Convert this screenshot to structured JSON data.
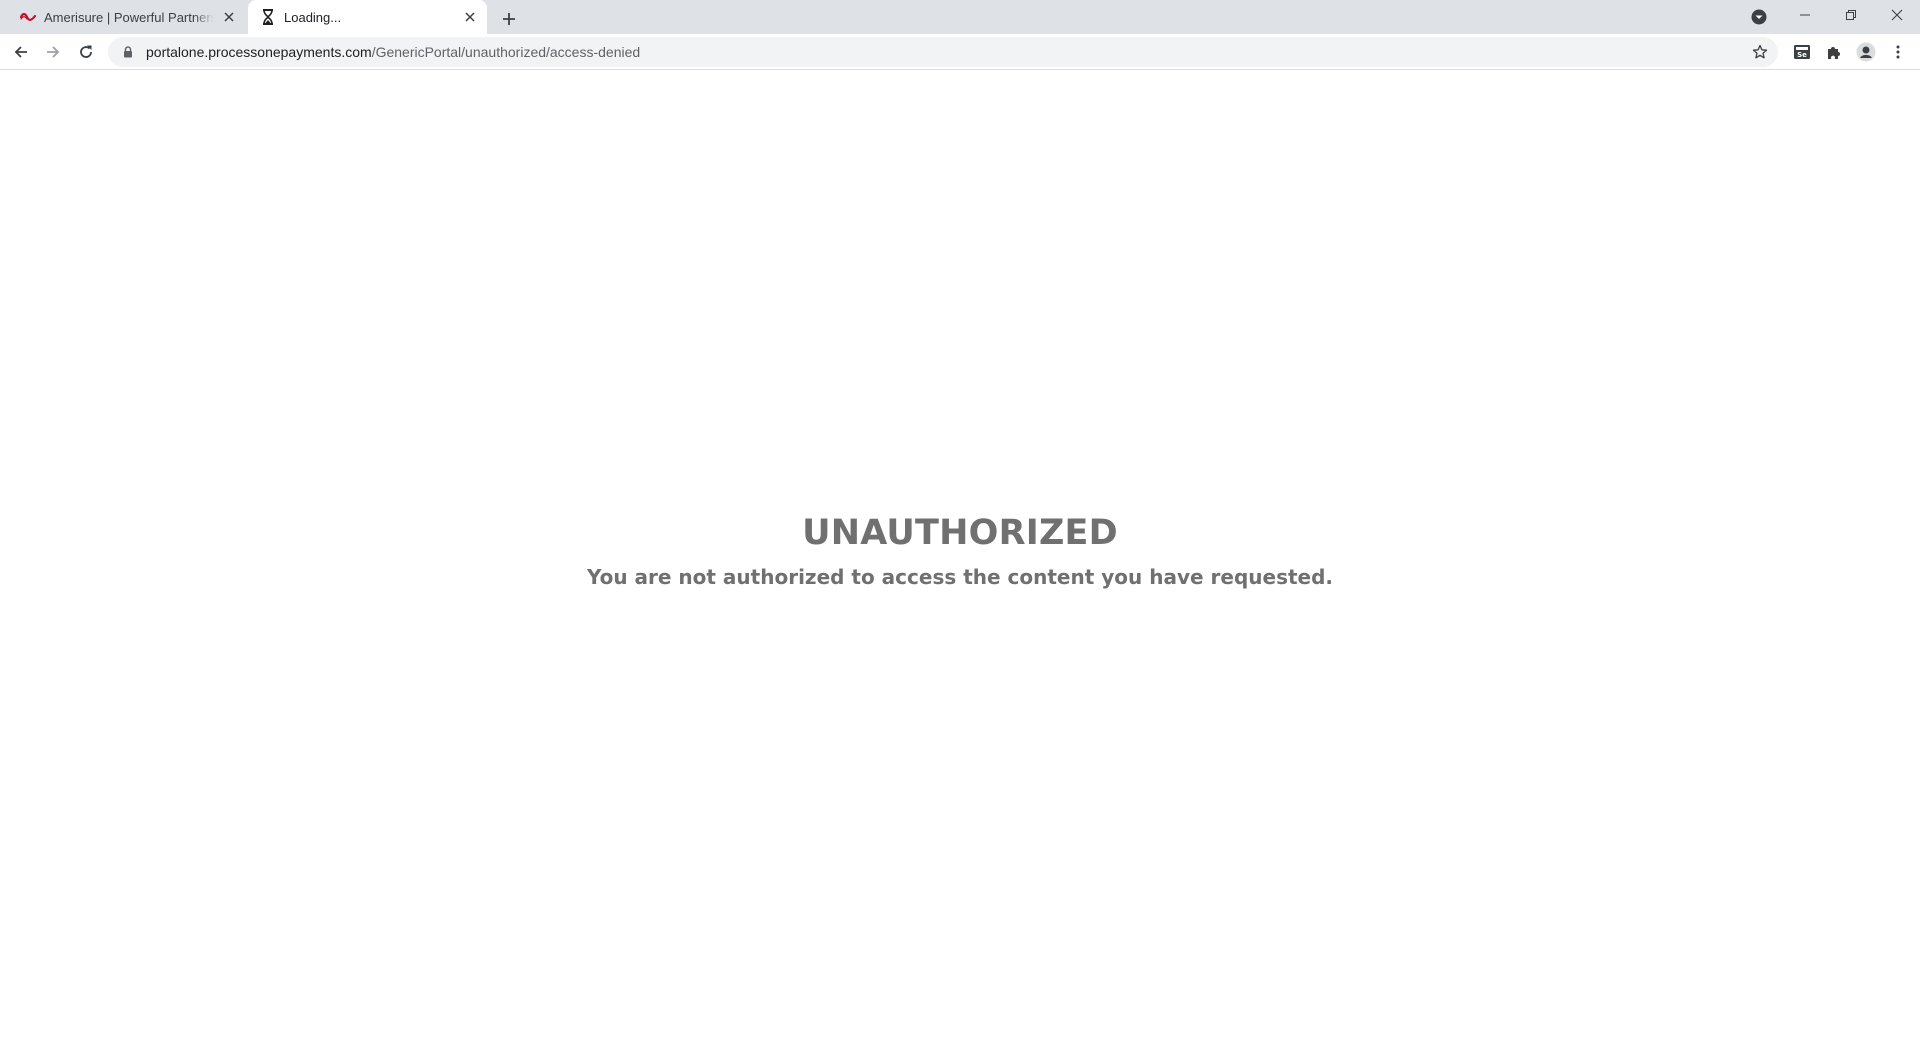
{
  "browser": {
    "tabs": [
      {
        "title": "Amerisure | Powerful Partnerships",
        "favicon": "amerisure-logo-icon",
        "active": false
      },
      {
        "title": "Loading...",
        "favicon": "hourglass-icon",
        "active": true
      }
    ],
    "url": {
      "host": "portalone.processonepayments.com",
      "path": "/GenericPortal/unauthorized/access-denied"
    },
    "colors": {
      "tabstrip": "#dee1e6",
      "omnibox": "#f1f3f4",
      "icon": "#5f6368",
      "brand_red": "#c8102e"
    }
  },
  "page": {
    "heading": "UNAUTHORIZED",
    "message": "You are not authorized to access the content you have requested.",
    "text_color": "#707070"
  }
}
